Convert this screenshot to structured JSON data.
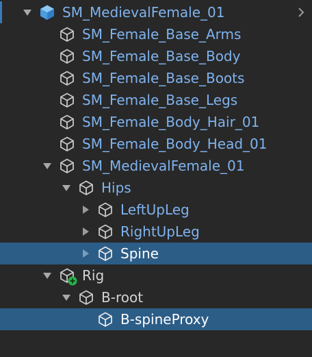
{
  "colors": {
    "background": "#282828",
    "selection": "#2c5d87",
    "prefab_text": "#7fb3ef",
    "prefab_icon": "#5aa7e8",
    "normal_text": "#d4d4d4",
    "add_badge": "#28b24a"
  },
  "hierarchy": {
    "items": [
      {
        "label": "SM_MedievalFemale_01",
        "icon": "prefab-root-cube-icon",
        "expanded": true
      },
      {
        "label": "SM_Female_Base_Arms",
        "icon": "prefab-cube-icon"
      },
      {
        "label": "SM_Female_Base_Body",
        "icon": "prefab-cube-icon"
      },
      {
        "label": "SM_Female_Base_Boots",
        "icon": "prefab-cube-icon"
      },
      {
        "label": "SM_Female_Base_Legs",
        "icon": "prefab-cube-icon"
      },
      {
        "label": "SM_Female_Body_Hair_01",
        "icon": "prefab-cube-icon"
      },
      {
        "label": "SM_Female_Body_Head_01",
        "icon": "prefab-cube-icon"
      },
      {
        "label": "SM_MedievalFemale_01",
        "icon": "prefab-cube-icon",
        "expanded": true
      },
      {
        "label": "Hips",
        "icon": "prefab-cube-icon",
        "expanded": true
      },
      {
        "label": "LeftUpLeg",
        "icon": "prefab-cube-icon",
        "expanded": false
      },
      {
        "label": "RightUpLeg",
        "icon": "prefab-cube-icon",
        "expanded": false
      },
      {
        "label": "Spine",
        "icon": "prefab-cube-icon",
        "expanded": false,
        "selected": true
      },
      {
        "label": "Rig",
        "icon": "added-gameobject-icon",
        "expanded": true
      },
      {
        "label": "B-root",
        "icon": "gameobject-cube-icon",
        "expanded": true
      },
      {
        "label": "B-spineProxy",
        "icon": "gameobject-cube-icon",
        "selected": true
      }
    ]
  }
}
